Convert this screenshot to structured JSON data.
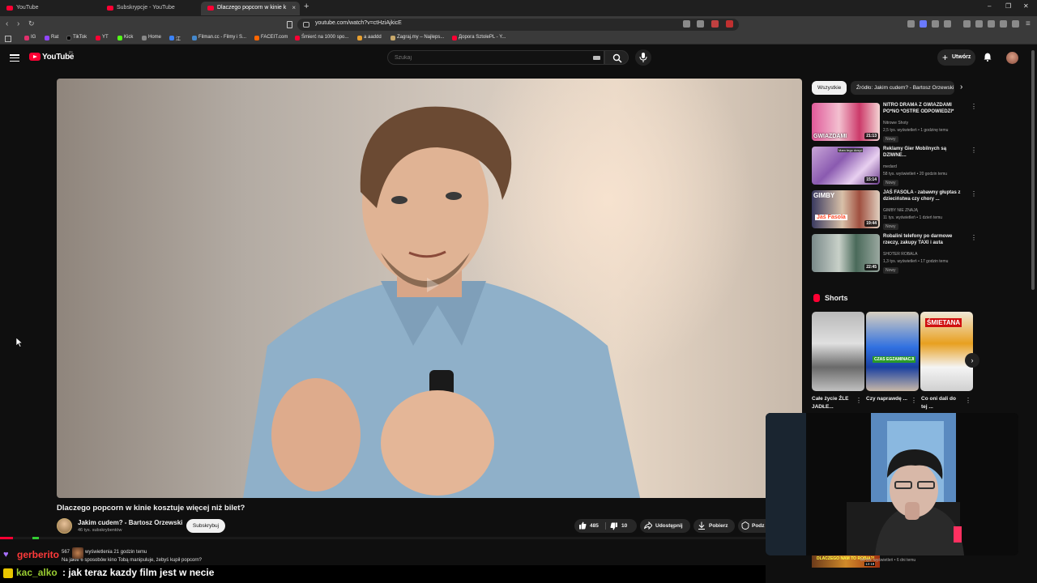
{
  "browser": {
    "tabs": [
      {
        "label": "YouTube",
        "active": false
      },
      {
        "label": "Subskrypcje - YouTube",
        "active": false
      },
      {
        "label": "Dlaczego popcorn w kinie k",
        "active": true
      }
    ],
    "new_tab_label": "+",
    "url": "youtube.com/watch?v=ctHziAjkicE",
    "bookmarks": [
      "IG",
      "Rat",
      "TikTok",
      "YT",
      "Kick",
      "Home",
      "江",
      "Filman.cc - Filmy i S...",
      "FACEIT.com",
      "Śmierć na 1000 spo...",
      "a aaddd",
      "Zagraj.my – Najleps...",
      "Дорога SztolePL - Y..."
    ]
  },
  "youtube": {
    "wordmark": "YouTube",
    "country": "PL",
    "search_placeholder": "Szukaj",
    "create_label": "Utwórz"
  },
  "video": {
    "title": "Dlaczego popcorn w kinie kosztuje więcej niż bilet?",
    "channel": "Jakim cudem? - Bartosz Orzewski",
    "subscribers": "46 tys. subskrybentów",
    "subscribe_label": "Subskrybuj",
    "likes": "485",
    "dislikes": "10",
    "share_label": "Udostępnij",
    "download_label": "Pobierz",
    "thanks_label": "Podz",
    "views": "567",
    "views_suffix": "wyświetlenia  21 godzin temu",
    "description": "Na jakie 6 sposobów kino Tobą manipuluje, żebyś kupił popcorn?"
  },
  "sidebar": {
    "chips": [
      {
        "label": "Wszystkie",
        "active": true
      },
      {
        "label": "Źródło: Jakim cudem? - Bartosz Orzewski",
        "active": false
      }
    ],
    "recommendations": [
      {
        "title": "NITRO DRAMA Z GWIAZDAMI PO*NO *OSTRE ODPOWIEDZI*",
        "channel": "Nitrowe Shoty",
        "meta": "2,5 tys. wyświetleń • 1 godzinę temu",
        "badge": "Nowy",
        "duration": "21:13",
        "thumb_text": "GWIAZDAMI"
      },
      {
        "title": "Reklamy Gier Mobilnych są DZIWNE...",
        "channel": "medard",
        "meta": "58 tys. wyświetleń • 20 godzin temu",
        "badge": "Nowy",
        "duration": "15:14",
        "thumb_text": "Mam tego dosyć"
      },
      {
        "title": "JAŚ FASOLA - zabawny głuptas z dzieciństwa czy chory ...",
        "channel": "GIMBY NIE ZNAJĄ",
        "meta": "11 tys. wyświetleń • 1 dzień temu",
        "badge": "Nowy",
        "duration": "19:44",
        "thumb_text": "GIMBY"
      },
      {
        "title": "Robalini telefony po darmowe rzeczy, zakupy TAXI i auta",
        "channel": "SHOTER ROBALA",
        "meta": "1,3 tys. wyświetleń • 17 godzin temu",
        "badge": "Nowy",
        "duration": "22:45",
        "thumb_text": ""
      }
    ],
    "shorts_title": "Shorts",
    "shorts": [
      {
        "title": "Całe życie ŹLE JADŁE...",
        "overlay": ""
      },
      {
        "title": "Czy naprawdę ...",
        "overlay": "CZAS EGZAMINACJI"
      },
      {
        "title": "Co oni dali do tej ...",
        "overlay": "ŚMIETANA"
      }
    ],
    "last_item_meta": "64 tys. wyświetleń • 6 dni temu",
    "last_item_thumb_text": "DLACZEGO NAM TO ROBIA?!",
    "last_item_duration": "13:19"
  },
  "stream_chat": [
    {
      "user": "gerberito",
      "message": ""
    },
    {
      "user": "kac_alko",
      "message": ": jak teraz kazdy film jest w necie"
    }
  ],
  "colors": {
    "yt_red": "#ff0033",
    "bg": "#0f0f0f",
    "chip_active": "#f1f1f1",
    "chat_user1": "#ff3a3a",
    "chat_user2": "#9acd32"
  }
}
